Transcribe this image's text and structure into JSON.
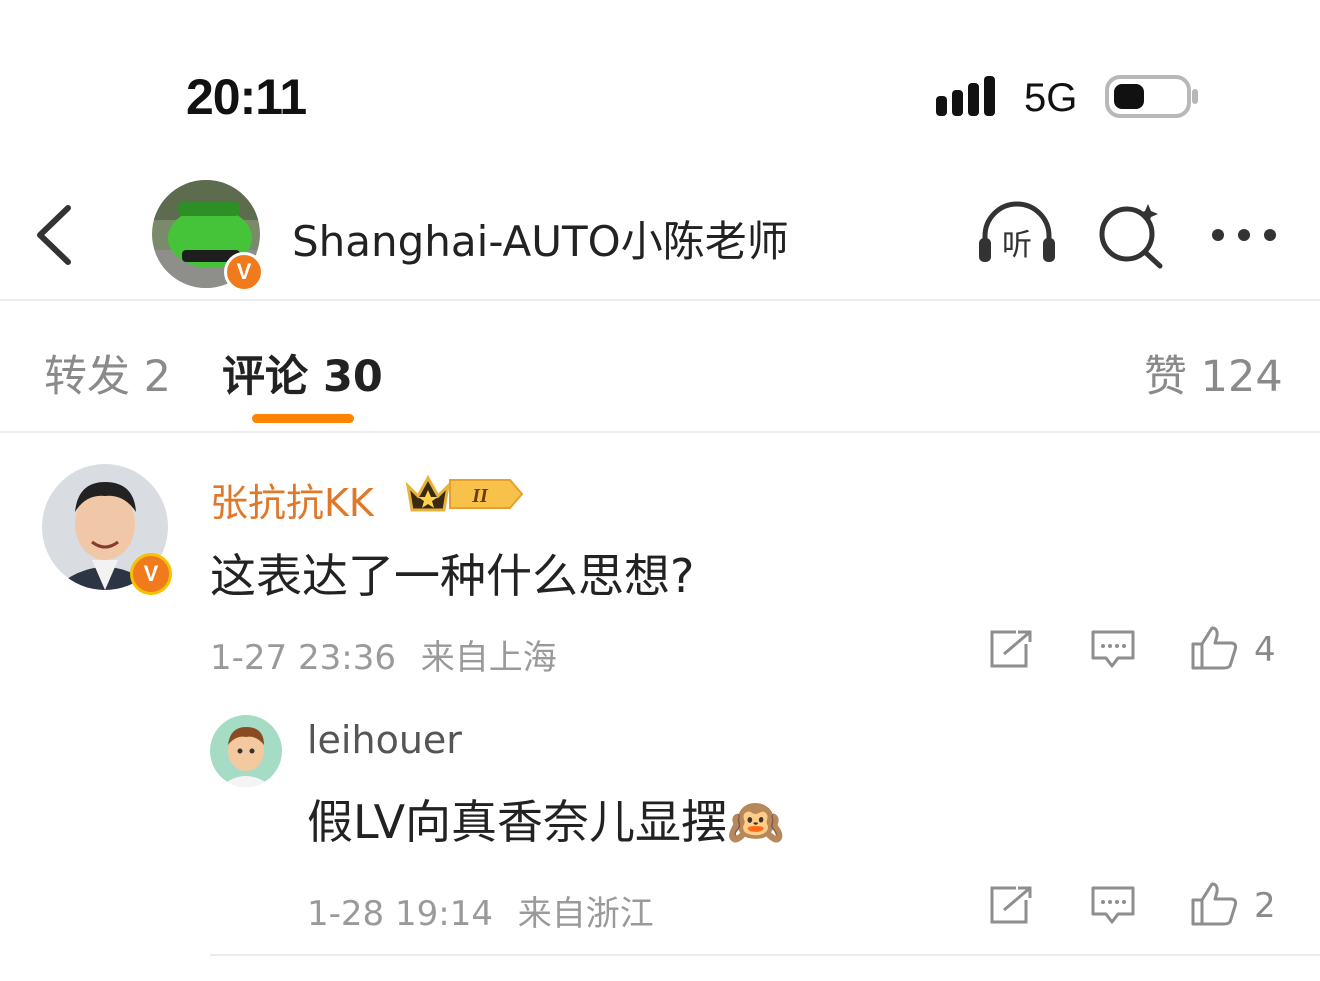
{
  "status_bar": {
    "time": "20:11",
    "network": "5G"
  },
  "header": {
    "title": "Shanghai-AUTO小陈老师",
    "listen_label": "听"
  },
  "tabs": [
    {
      "label": "转发 2"
    },
    {
      "label": "评论 30"
    },
    {
      "label": "赞 124"
    }
  ],
  "comments": [
    {
      "user": "张抗抗KK",
      "rank_badge": "II",
      "text": "这表达了一种什么思想?",
      "time": "1-27 23:36",
      "location": "来自上海",
      "likes": "4"
    },
    {
      "user": "leihouer",
      "text": "假LV向真香奈儿显摆🙉",
      "time": "1-28 19:14",
      "location": "来自浙江",
      "likes": "2"
    }
  ],
  "colors": {
    "accent": "#ff8200",
    "verified": "#f07a1c",
    "username_vip": "#e0782a"
  }
}
